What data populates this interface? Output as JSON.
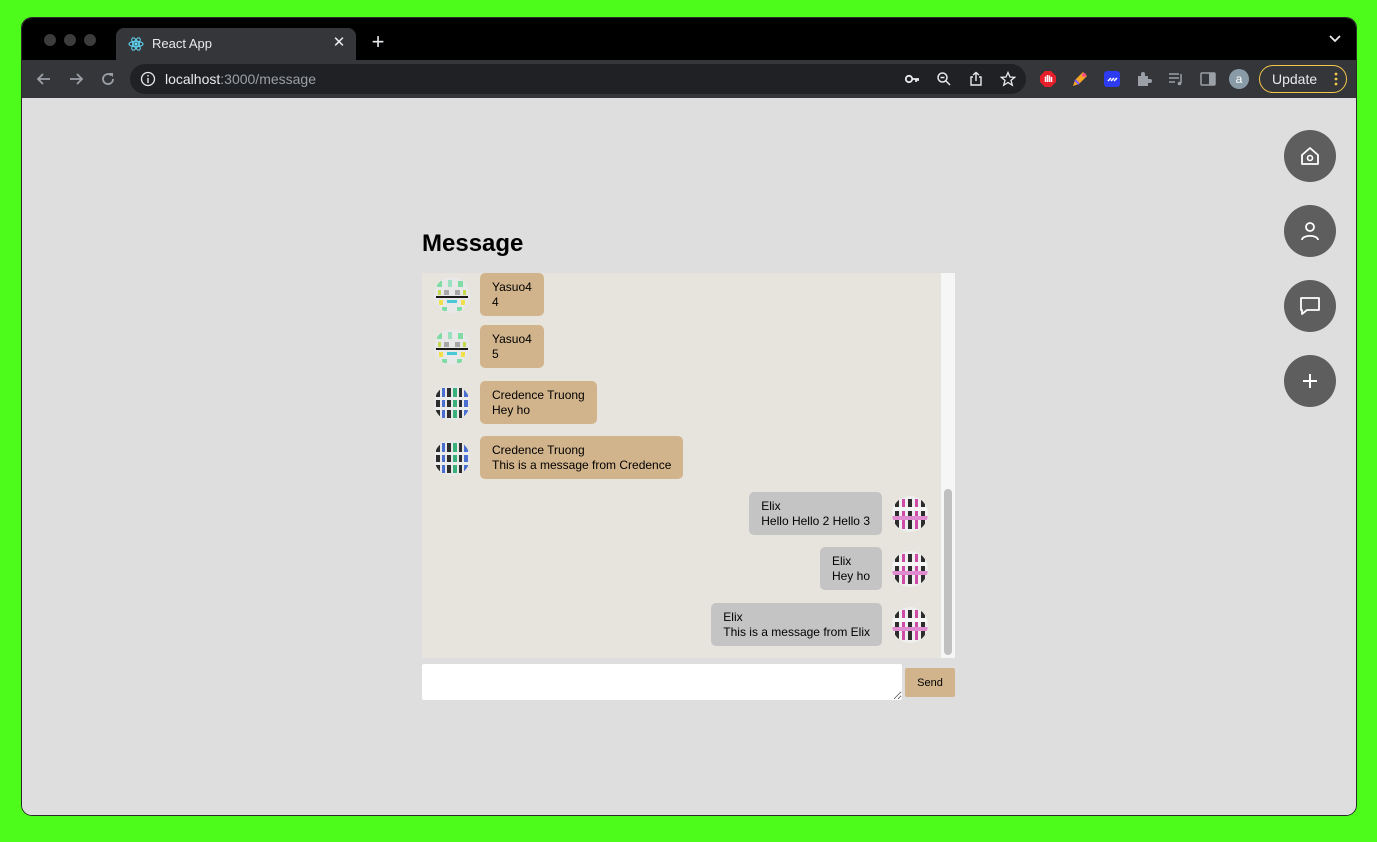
{
  "browser": {
    "tab": {
      "title": "React App",
      "favicon": "react-icon"
    },
    "url": {
      "host": "localhost",
      "path": ":3000/message"
    },
    "update_label": "Update",
    "profile_initial": "a"
  },
  "page": {
    "title": "Message",
    "messages": [
      {
        "sender": "Yasuo4",
        "text": "4",
        "side": "left"
      },
      {
        "sender": "Yasuo4",
        "text": "5",
        "side": "left"
      },
      {
        "sender": "Credence Truong",
        "text": "Hey ho",
        "side": "left"
      },
      {
        "sender": "Credence Truong",
        "text": "This is a message from Credence",
        "side": "left"
      },
      {
        "sender": "Elix",
        "text": "Hello Hello 2 Hello 3",
        "side": "right"
      },
      {
        "sender": "Elix",
        "text": "Hey ho",
        "side": "right"
      },
      {
        "sender": "Elix",
        "text": "This is a message from Elix",
        "side": "right"
      }
    ],
    "input": {
      "value": "",
      "placeholder": ""
    },
    "send_label": "Send",
    "side_buttons": [
      "home-icon",
      "user-icon",
      "chat-icon",
      "plus-icon"
    ]
  },
  "colors": {
    "other_bubble": "#d2b48c",
    "self_bubble": "#c4c4c4",
    "chat_background": "#e7e4de",
    "page_background": "#dedede",
    "fab": "#5e5e5e"
  }
}
